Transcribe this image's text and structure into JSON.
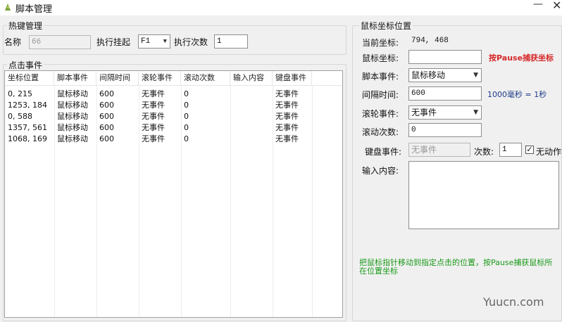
{
  "window": {
    "title": "脚本管理",
    "minimize": "—",
    "close": "✕"
  },
  "hotkey_group": {
    "legend": "热键管理",
    "name_label": "名称",
    "name_value": "66",
    "hotkey_label": "执行挂起",
    "hotkey_value": "F1",
    "count_label": "执行次数",
    "count_value": "1"
  },
  "events_group": {
    "legend": "点击事件",
    "columns": [
      "坐标位置",
      "脚本事件",
      "间隔时间",
      "滚轮事件",
      "滚动次数",
      "输入内容",
      "键盘事件"
    ],
    "rows": [
      [
        "0, 215",
        "鼠标移动",
        "600",
        "无事件",
        "0",
        "",
        "无事件"
      ],
      [
        "1253, 184",
        "鼠标移动",
        "600",
        "无事件",
        "0",
        "",
        "无事件"
      ],
      [
        "0, 588",
        "鼠标移动",
        "600",
        "无事件",
        "0",
        "",
        "无事件"
      ],
      [
        "1357, 561",
        "鼠标移动",
        "600",
        "无事件",
        "0",
        "",
        "无事件"
      ],
      [
        "1068, 169",
        "鼠标移动",
        "600",
        "无事件",
        "0",
        "",
        "无事件"
      ]
    ]
  },
  "mouse_group": {
    "legend": "鼠标坐标位置",
    "current_label": "当前坐标:",
    "current_value": "794, 468",
    "coord_label": "鼠标坐标:",
    "coord_value": "",
    "capture_hint": "按Pause捕获坐标",
    "script_event_label": "脚本事件:",
    "script_event_value": "鼠标移动",
    "interval_label": "间隔时间:",
    "interval_value": "600",
    "interval_hint": "1000毫秒 = 1秒",
    "wheel_label": "滚轮事件:",
    "wheel_value": "无事件",
    "scroll_label": "滚动次数:",
    "scroll_value": "0",
    "key_label": "键盘事件:",
    "key_value": "无事件",
    "times_label": "次数:",
    "times_value": "1",
    "no_action_label": "无动作",
    "no_action_check": "✓",
    "input_label": "输入内容:",
    "input_value": "",
    "help_text": "把鼠标指针移动到指定点击的位置，按Pause捕获鼠标所在位置坐标"
  },
  "watermark": "Yuucn.com",
  "colors": {
    "hint_red": "#d62828",
    "hint_blue": "#1d3a8a",
    "hint_green": "#1a9a1a"
  }
}
